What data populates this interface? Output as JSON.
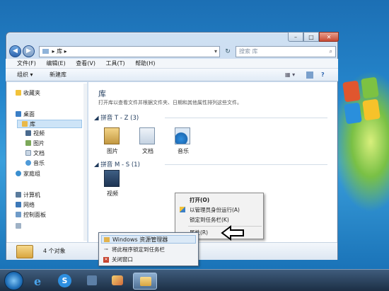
{
  "window": {
    "breadcrumb": "▸ 库 ▸",
    "search_placeholder": "搜索 库"
  },
  "menu": [
    "文件(F)",
    "编辑(E)",
    "查看(V)",
    "工具(T)",
    "帮助(H)"
  ],
  "toolbar": {
    "organize": "组织 ▾",
    "new_library": "新建库"
  },
  "sidebar": {
    "favorites": "收藏夹",
    "desktop": "桌面",
    "libraries": "库",
    "video": "视频",
    "pictures": "图片",
    "documents": "文档",
    "music": "音乐",
    "homegroup": "家庭组",
    "computer": "计算机",
    "network": "网络",
    "control_panel": "控制面板"
  },
  "content": {
    "title": "库",
    "description": "打开库以查看文件并根据文件夹、日期和其他属性排列这些文件。",
    "group1": "拼音 T - Z (3)",
    "group2": "拼音 M - S (1)",
    "items": [
      {
        "label": "图片",
        "icon": "pictures-library-icon"
      },
      {
        "label": "文档",
        "icon": "documents-library-icon"
      },
      {
        "label": "音乐",
        "icon": "music-library-icon"
      }
    ],
    "video": "视频"
  },
  "status": {
    "count": "4 个对象"
  },
  "context_menu": {
    "open": "打开(O)",
    "run_as_admin": "以管理员身份运行(A)",
    "pin_taskbar": "锁定到任务栏(K)",
    "properties": "属性(R)"
  },
  "jump_list": {
    "explorer": "Windows 资源管理器",
    "pin_program": "将此程序锁定到任务栏",
    "close_window": "关闭窗口"
  },
  "colors": {
    "accent": "#2f66b0",
    "taskbar": "#1c2f45",
    "window_frame": "#bcd3ec"
  }
}
